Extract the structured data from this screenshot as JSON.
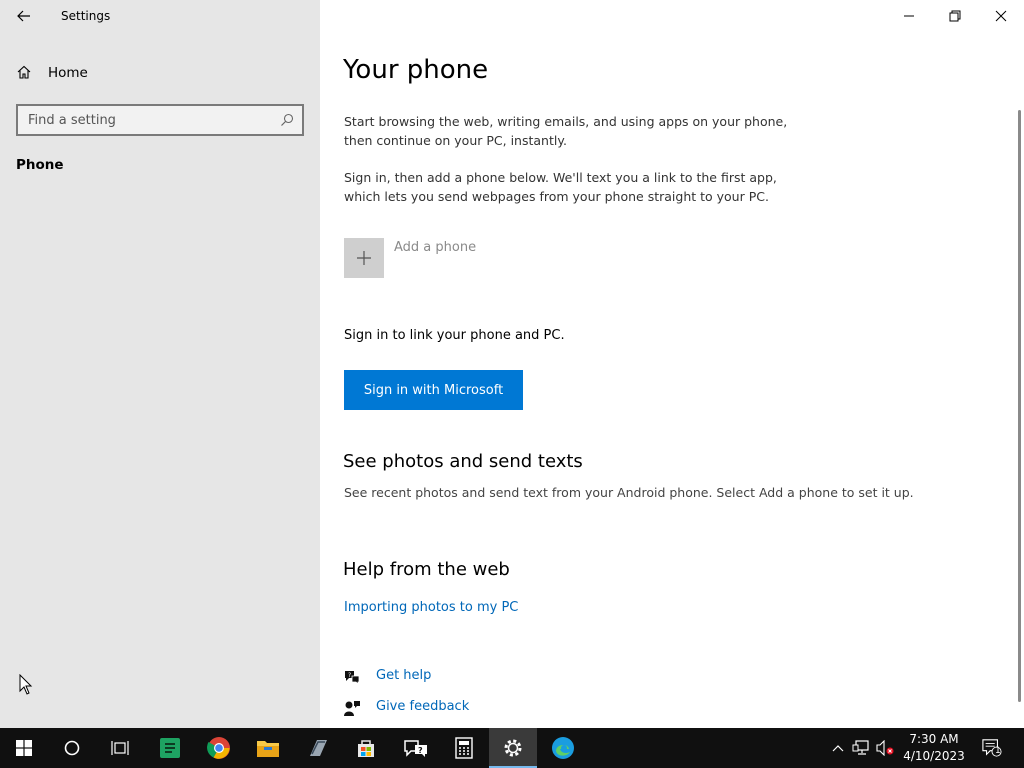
{
  "window": {
    "title": "Settings"
  },
  "sidebar": {
    "home_label": "Home",
    "search_placeholder": "Find a setting",
    "current_section": "Phone"
  },
  "main": {
    "title": "Your phone",
    "intro_paragraph": "Start browsing the web, writing emails, and using apps on your phone, then continue on your PC, instantly.",
    "signin_paragraph": "Sign in, then add a phone below. We'll text you a link to the first app, which lets you send webpages from your phone straight to your PC.",
    "add_phone_label": "Add a phone",
    "link_prompt": "Sign in to link your phone and PC.",
    "signin_button": "Sign in with Microsoft",
    "photos_heading": "See photos and send texts",
    "photos_description": "See recent photos and send text from your Android phone. Select Add a phone to set it up.",
    "help_heading": "Help from the web",
    "help_link": "Importing photos to my PC",
    "get_help": "Get help",
    "give_feedback": "Give feedback"
  },
  "taskbar": {
    "apps": [
      "start-icon",
      "cortana-icon",
      "task-view-icon",
      "spreadsheet-app-icon",
      "chrome-icon",
      "file-explorer-icon",
      "app-icon",
      "store-icon",
      "help-app-icon",
      "calculator-icon",
      "settings-icon",
      "edge-icon"
    ],
    "active_app": "settings-icon",
    "time": "7:30 AM",
    "date": "4/10/2023",
    "notification_count": "1"
  },
  "colors": {
    "accent": "#0078d4",
    "link": "#0067b8",
    "sidebar_bg": "#e6e6e6",
    "taskbar_bg": "#101010"
  }
}
